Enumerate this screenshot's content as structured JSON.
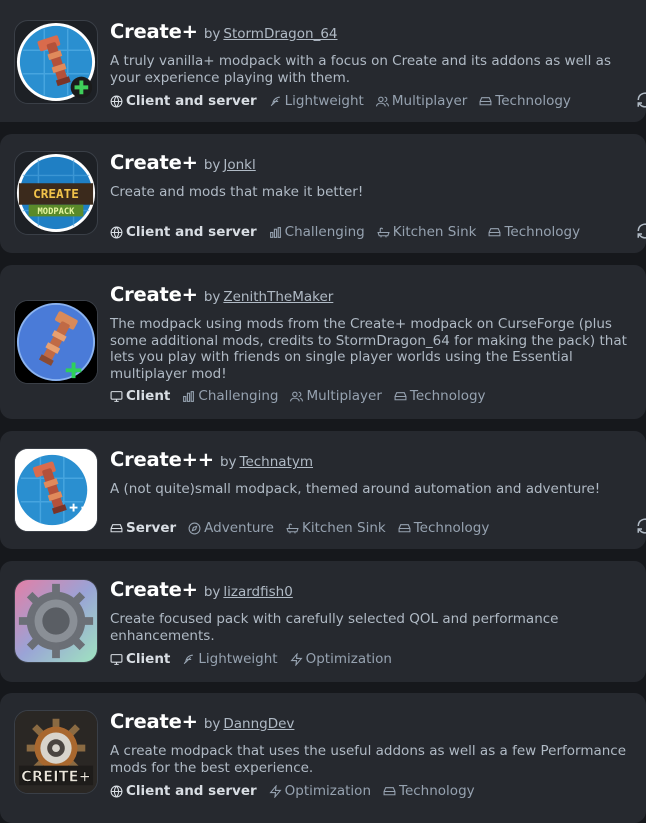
{
  "by_label": "by",
  "projects": [
    {
      "title": "Create+",
      "author": "StormDragon_64",
      "description": "A truly vanilla+ modpack with a focus on Create and its addons as well as your experience playing with them.",
      "environment": {
        "label": "Client and server",
        "icon": "globe-icon"
      },
      "tags": [
        {
          "label": "Lightweight",
          "icon": "feather-icon"
        },
        {
          "label": "Multiplayer",
          "icon": "users-icon"
        },
        {
          "label": "Technology",
          "icon": "hard-drive-icon"
        }
      ]
    },
    {
      "title": "Create+",
      "author": "Jonkl",
      "description": "Create and mods that make it better!",
      "icon_text": [
        "CREATE",
        "MODPACK"
      ],
      "environment": {
        "label": "Client and server",
        "icon": "globe-icon"
      },
      "tags": [
        {
          "label": "Challenging",
          "icon": "chart-icon"
        },
        {
          "label": "Kitchen Sink",
          "icon": "bath-icon"
        },
        {
          "label": "Technology",
          "icon": "hard-drive-icon"
        }
      ]
    },
    {
      "title": "Create+",
      "author": "ZenithTheMaker",
      "description": "The modpack using mods from the Create+ modpack on CurseForge (plus some additional mods, credits to StormDragon_64 for making the pack) that lets you play with friends on single player worlds using the Essential multiplayer mod!",
      "environment": {
        "label": "Client",
        "icon": "monitor-icon"
      },
      "tags": [
        {
          "label": "Challenging",
          "icon": "chart-icon"
        },
        {
          "label": "Multiplayer",
          "icon": "users-icon"
        },
        {
          "label": "Technology",
          "icon": "hard-drive-icon"
        }
      ]
    },
    {
      "title": "Create++",
      "author": "Technatym",
      "description": "A (not quite)small modpack, themed around automation and adventure!",
      "environment": {
        "label": "Server",
        "icon": "server-icon"
      },
      "tags": [
        {
          "label": "Adventure",
          "icon": "compass-icon"
        },
        {
          "label": "Kitchen Sink",
          "icon": "bath-icon"
        },
        {
          "label": "Technology",
          "icon": "hard-drive-icon"
        }
      ]
    },
    {
      "title": "Create+",
      "author": "lizardfish0",
      "description": "Create focused pack with carefully selected QOL and performance enhancements.",
      "environment": {
        "label": "Client",
        "icon": "monitor-icon"
      },
      "tags": [
        {
          "label": "Lightweight",
          "icon": "feather-icon"
        },
        {
          "label": "Optimization",
          "icon": "zap-icon"
        }
      ]
    },
    {
      "title": "Create+",
      "author": "DanngDev",
      "description": "A create modpack that uses the useful addons as well as a few Performance mods for the best experience.",
      "icon_text": [
        "CREITE+"
      ],
      "environment": {
        "label": "Client and server",
        "icon": "globe-icon"
      },
      "tags": [
        {
          "label": "Optimization",
          "icon": "zap-icon"
        },
        {
          "label": "Technology",
          "icon": "hard-drive-icon"
        }
      ]
    }
  ]
}
